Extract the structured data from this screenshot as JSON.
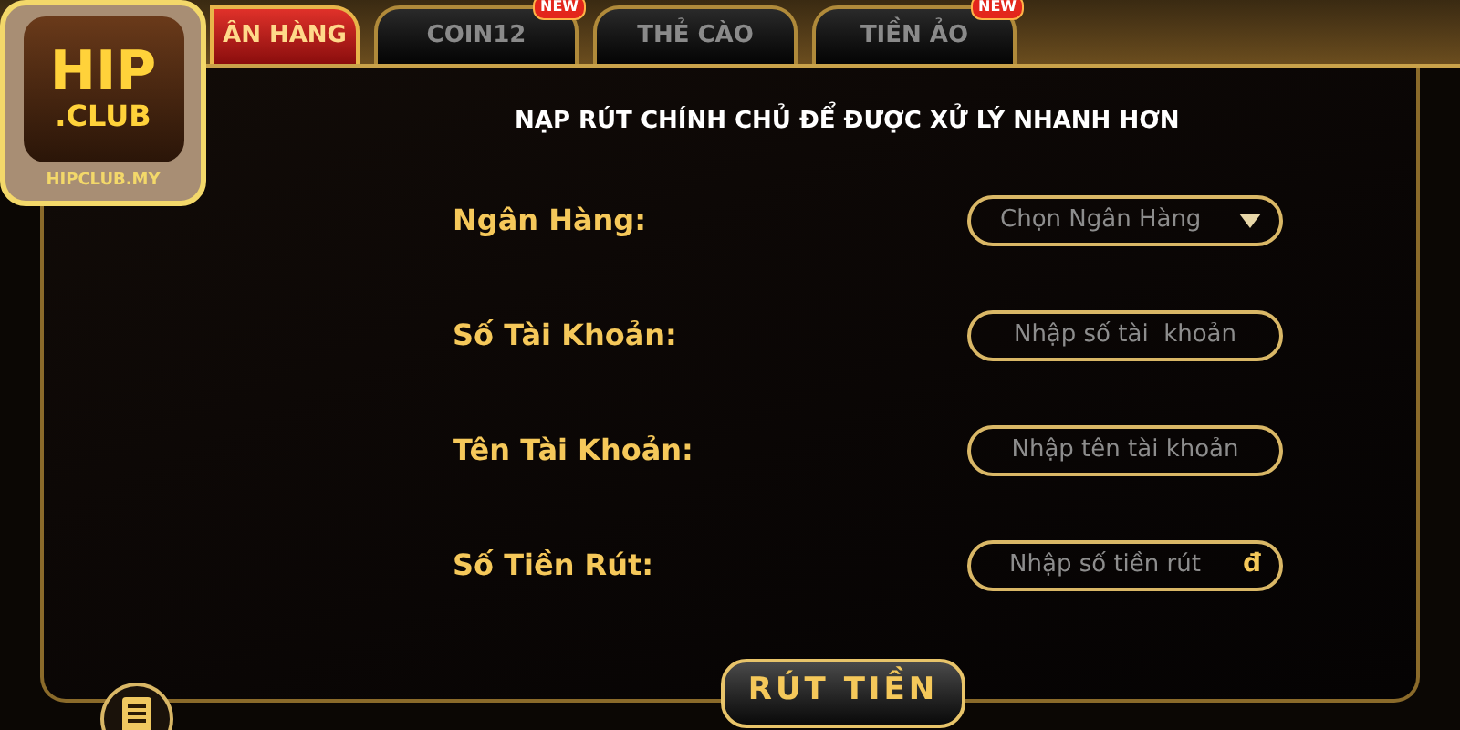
{
  "logo": {
    "title": "HIP",
    "subtitle": ".CLUB",
    "site": "HIPCLUB.MY"
  },
  "tabs": [
    {
      "label": "ÂN HÀNG",
      "selected": true
    },
    {
      "label": "COIN12",
      "selected": false,
      "badge": "NEW"
    },
    {
      "label": "THẺ CÀO",
      "selected": false
    },
    {
      "label": "TIỀN ẢO",
      "selected": false,
      "badge": "NEW"
    }
  ],
  "heading": "NẠP RÚT CHÍNH CHỦ ĐỂ ĐƯỢC XỬ LÝ NHANH HƠN",
  "fields": [
    {
      "kind": "select",
      "label": "Ngân Hàng:",
      "placeholder": "Chọn Ngân Hàng"
    },
    {
      "kind": "input",
      "label": "Số Tài Khoản:",
      "placeholder": "Nhập số tài  khoản"
    },
    {
      "kind": "input",
      "label": "Tên Tài Khoản:",
      "placeholder": "Nhập tên tài khoản"
    },
    {
      "kind": "input",
      "label": "Số Tiền Rút:",
      "placeholder": "Nhập số tiền rút",
      "suffix": "đ"
    }
  ],
  "submit": "RÚT TIỀN"
}
